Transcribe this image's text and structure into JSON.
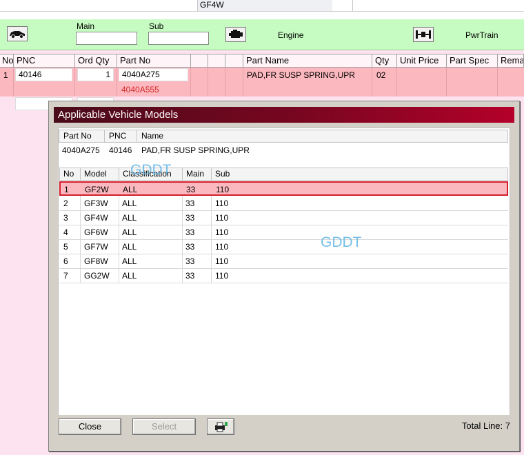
{
  "top": {
    "model": "GF4W"
  },
  "toolbar": {
    "main_label": "Main",
    "sub_label": "Sub",
    "main_value": "",
    "sub_value": "",
    "engine_label": "Engine",
    "pwrtrain_label": "PwrTrain",
    "icons": [
      "car-icon",
      "engine-icon",
      "powertrain-icon"
    ]
  },
  "grid": {
    "headers": [
      "No",
      "PNC",
      "Ord Qty",
      "Part No",
      "",
      "",
      "",
      "Part Name",
      "Qty",
      "Unit Price",
      "Part Spec",
      "Rema"
    ],
    "row": {
      "no": "1",
      "pnc": "40146",
      "ord_qty": "1",
      "part_no": "4040A275",
      "part_no_alt": "4040A555",
      "part_name": "PAD,FR SUSP SPRING,UPR",
      "qty": "02"
    }
  },
  "dialog": {
    "title": "Applicable Vehicle Models",
    "info_headers": [
      "Part No",
      "PNC",
      "Name"
    ],
    "info": {
      "part_no": "4040A275",
      "pnc": "40146",
      "name": "PAD,FR SUSP SPRING,UPR"
    },
    "list_headers": [
      "No",
      "Model",
      "Classification",
      "Main",
      "Sub"
    ],
    "rows": [
      {
        "no": "1",
        "model": "GF2W",
        "classification": "ALL",
        "main": "33",
        "sub": "110"
      },
      {
        "no": "2",
        "model": "GF3W",
        "classification": "ALL",
        "main": "33",
        "sub": "110"
      },
      {
        "no": "3",
        "model": "GF4W",
        "classification": "ALL",
        "main": "33",
        "sub": "110"
      },
      {
        "no": "4",
        "model": "GF6W",
        "classification": "ALL",
        "main": "33",
        "sub": "110"
      },
      {
        "no": "5",
        "model": "GF7W",
        "classification": "ALL",
        "main": "33",
        "sub": "110"
      },
      {
        "no": "6",
        "model": "GF8W",
        "classification": "ALL",
        "main": "33",
        "sub": "110"
      },
      {
        "no": "7",
        "model": "GG2W",
        "classification": "ALL",
        "main": "33",
        "sub": "110"
      }
    ],
    "watermark": "GDDT",
    "close_label": "Close",
    "select_label": "Select",
    "total_line": "Total Line: 7",
    "print_icon": "printer-icon"
  },
  "colors": {
    "toolbar_bg": "#c6fcc1",
    "selected_row": "#fcb8bf",
    "selected_border": "#d21e2a",
    "title_bar": "#7a0620",
    "watermark": "#5fb5e6",
    "alt_part_no": "#d02a2a"
  }
}
